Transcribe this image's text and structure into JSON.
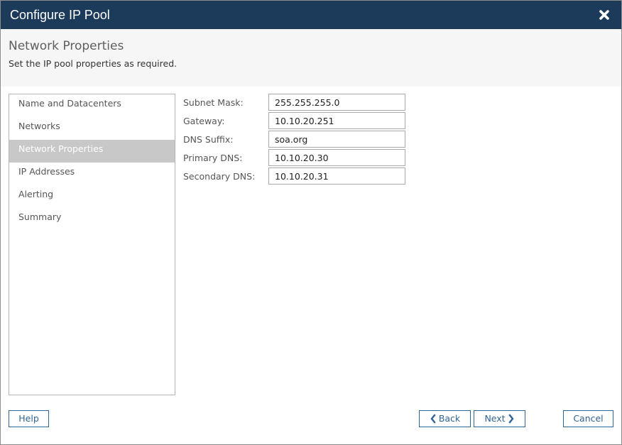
{
  "dialog": {
    "title": "Configure IP Pool",
    "close_icon": "close-icon"
  },
  "header": {
    "title": "Network Properties",
    "description": "Set the IP pool properties as required."
  },
  "steps": [
    {
      "label": "Name and Datacenters",
      "active": false
    },
    {
      "label": "Networks",
      "active": false
    },
    {
      "label": "Network Properties",
      "active": true
    },
    {
      "label": "IP Addresses",
      "active": false
    },
    {
      "label": "Alerting",
      "active": false
    },
    {
      "label": "Summary",
      "active": false
    }
  ],
  "form": {
    "subnet_mask": {
      "label": "Subnet Mask:",
      "value": "255.255.255.0"
    },
    "gateway": {
      "label": "Gateway:",
      "value": "10.10.20.251"
    },
    "dns_suffix": {
      "label": "DNS Suffix:",
      "value": "soa.org"
    },
    "primary_dns": {
      "label": "Primary DNS:",
      "value": "10.10.20.30"
    },
    "secondary_dns": {
      "label": "Secondary DNS:",
      "value": "10.10.20.31"
    }
  },
  "footer": {
    "help_label": "Help",
    "back_label": "Back",
    "back_icon": "chevron-left-icon",
    "next_label": "Next",
    "next_icon": "chevron-right-icon",
    "cancel_label": "Cancel"
  },
  "colors": {
    "titlebar": "#1c3a5a",
    "accent": "#2f6496",
    "active_step": "#c8c8c8"
  }
}
